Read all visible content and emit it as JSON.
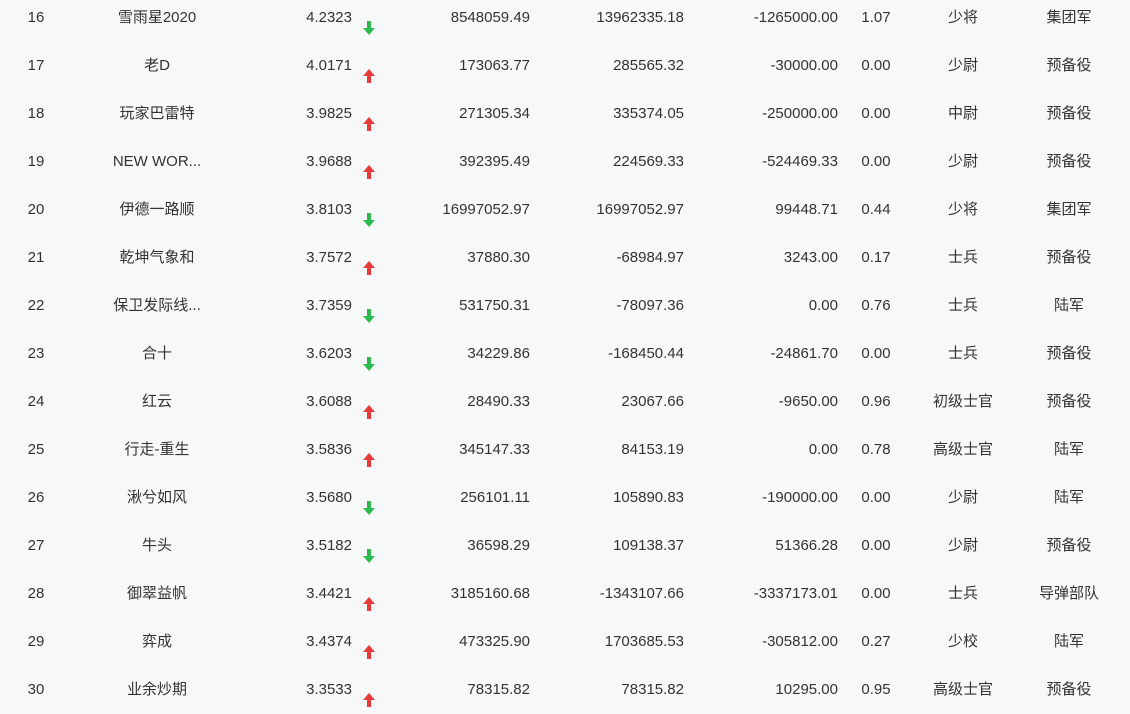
{
  "colors": {
    "background": "#f7f8fa",
    "text": "#333333",
    "up": "#e8393b",
    "down": "#2cb84c"
  },
  "rows": [
    {
      "rank": "16",
      "name": "雪雨星2020",
      "score": "4.2323",
      "trend": "down",
      "trend_icon": "arrow-down-icon",
      "v1": "8548059.49",
      "v2": "13962335.18",
      "v3": "-1265000.00",
      "ratio": "1.07",
      "title": "少将",
      "unit": "集团军"
    },
    {
      "rank": "17",
      "name": "老D",
      "score": "4.0171",
      "trend": "up",
      "trend_icon": "arrow-up-icon",
      "v1": "173063.77",
      "v2": "285565.32",
      "v3": "-30000.00",
      "ratio": "0.00",
      "title": "少尉",
      "unit": "预备役"
    },
    {
      "rank": "18",
      "name": "玩家巴雷特",
      "score": "3.9825",
      "trend": "up",
      "trend_icon": "arrow-up-icon",
      "v1": "271305.34",
      "v2": "335374.05",
      "v3": "-250000.00",
      "ratio": "0.00",
      "title": "中尉",
      "unit": "预备役"
    },
    {
      "rank": "19",
      "name": "NEW WOR...",
      "score": "3.9688",
      "trend": "up",
      "trend_icon": "arrow-up-icon",
      "v1": "392395.49",
      "v2": "224569.33",
      "v3": "-524469.33",
      "ratio": "0.00",
      "title": "少尉",
      "unit": "预备役"
    },
    {
      "rank": "20",
      "name": "伊德一路顺",
      "score": "3.8103",
      "trend": "down",
      "trend_icon": "arrow-down-icon",
      "v1": "16997052.97",
      "v2": "16997052.97",
      "v3": "99448.71",
      "ratio": "0.44",
      "title": "少将",
      "unit": "集团军"
    },
    {
      "rank": "21",
      "name": "乾坤气象和",
      "score": "3.7572",
      "trend": "up",
      "trend_icon": "arrow-up-icon",
      "v1": "37880.30",
      "v2": "-68984.97",
      "v3": "3243.00",
      "ratio": "0.17",
      "title": "士兵",
      "unit": "预备役"
    },
    {
      "rank": "22",
      "name": "保卫发际线...",
      "score": "3.7359",
      "trend": "down",
      "trend_icon": "arrow-down-icon",
      "v1": "531750.31",
      "v2": "-78097.36",
      "v3": "0.00",
      "ratio": "0.76",
      "title": "士兵",
      "unit": "陆军"
    },
    {
      "rank": "23",
      "name": "合十",
      "score": "3.6203",
      "trend": "down",
      "trend_icon": "arrow-down-icon",
      "v1": "34229.86",
      "v2": "-168450.44",
      "v3": "-24861.70",
      "ratio": "0.00",
      "title": "士兵",
      "unit": "预备役"
    },
    {
      "rank": "24",
      "name": "红云",
      "score": "3.6088",
      "trend": "up",
      "trend_icon": "arrow-up-icon",
      "v1": "28490.33",
      "v2": "23067.66",
      "v3": "-9650.00",
      "ratio": "0.96",
      "title": "初级士官",
      "unit": "预备役"
    },
    {
      "rank": "25",
      "name": "行走-重生",
      "score": "3.5836",
      "trend": "up",
      "trend_icon": "arrow-up-icon",
      "v1": "345147.33",
      "v2": "84153.19",
      "v3": "0.00",
      "ratio": "0.78",
      "title": "高级士官",
      "unit": "陆军"
    },
    {
      "rank": "26",
      "name": "湫兮如风",
      "score": "3.5680",
      "trend": "down",
      "trend_icon": "arrow-down-icon",
      "v1": "256101.11",
      "v2": "105890.83",
      "v3": "-190000.00",
      "ratio": "0.00",
      "title": "少尉",
      "unit": "陆军"
    },
    {
      "rank": "27",
      "name": "牛头",
      "score": "3.5182",
      "trend": "down",
      "trend_icon": "arrow-down-icon",
      "v1": "36598.29",
      "v2": "109138.37",
      "v3": "51366.28",
      "ratio": "0.00",
      "title": "少尉",
      "unit": "预备役"
    },
    {
      "rank": "28",
      "name": "御翠益帆",
      "score": "3.4421",
      "trend": "up",
      "trend_icon": "arrow-up-icon",
      "v1": "3185160.68",
      "v2": "-1343107.66",
      "v3": "-3337173.01",
      "ratio": "0.00",
      "title": "士兵",
      "unit": "导弹部队"
    },
    {
      "rank": "29",
      "name": "弈成",
      "score": "3.4374",
      "trend": "up",
      "trend_icon": "arrow-up-icon",
      "v1": "473325.90",
      "v2": "1703685.53",
      "v3": "-305812.00",
      "ratio": "0.27",
      "title": "少校",
      "unit": "陆军"
    },
    {
      "rank": "30",
      "name": "业余炒期",
      "score": "3.3533",
      "trend": "up",
      "trend_icon": "arrow-up-icon",
      "v1": "78315.82",
      "v2": "78315.82",
      "v3": "10295.00",
      "ratio": "0.95",
      "title": "高级士官",
      "unit": "预备役"
    }
  ]
}
